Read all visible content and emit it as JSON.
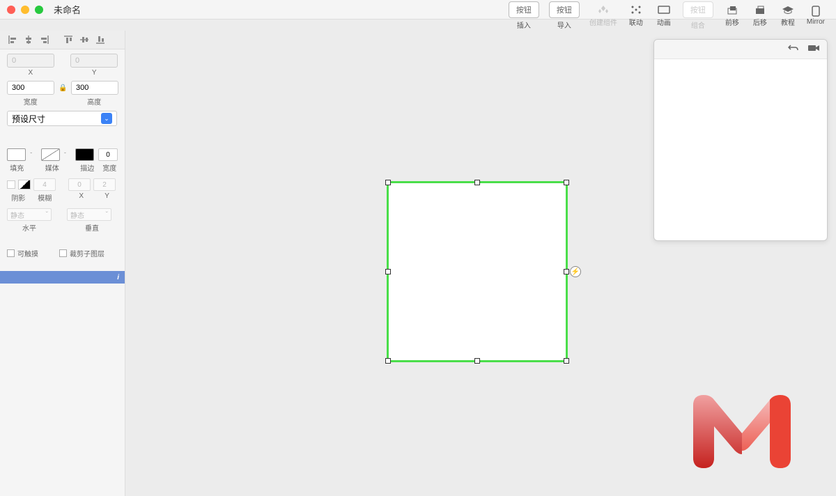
{
  "title": "未命名",
  "toolbar": {
    "insert_btn": "按钮",
    "insert_label": "插入",
    "import_btn": "按钮",
    "import_label": "导入",
    "create_component_label": "创建组件",
    "link_label": "联动",
    "animation_label": "动画",
    "combine_btn": "按钮",
    "combine_label": "组合",
    "forward_label": "前移",
    "backward_label": "后移",
    "tutorial_label": "教程",
    "mirror_label": "Mirror"
  },
  "props": {
    "x": "0",
    "y": "0",
    "x_label": "X",
    "y_label": "Y",
    "width": "300",
    "height": "300",
    "width_label": "宽度",
    "height_label": "高度",
    "preset": "预设尺寸"
  },
  "style": {
    "fill_label": "填充",
    "media_label": "媒体",
    "stroke_label": "描边",
    "stroke_width": "0",
    "stroke_width_label": "宽度",
    "shadow_label": "阴影",
    "blur_label": "模糊",
    "blur_value": "4",
    "shadow_x": "0",
    "shadow_y": "2",
    "shadow_x_label": "X",
    "shadow_y_label": "Y",
    "static": "静态",
    "horizontal_label": "水平",
    "vertical_label": "垂直"
  },
  "checks": {
    "touchable": "可触摸",
    "clip_children": "裁剪子图层"
  },
  "layer": {
    "indicator": "i"
  }
}
